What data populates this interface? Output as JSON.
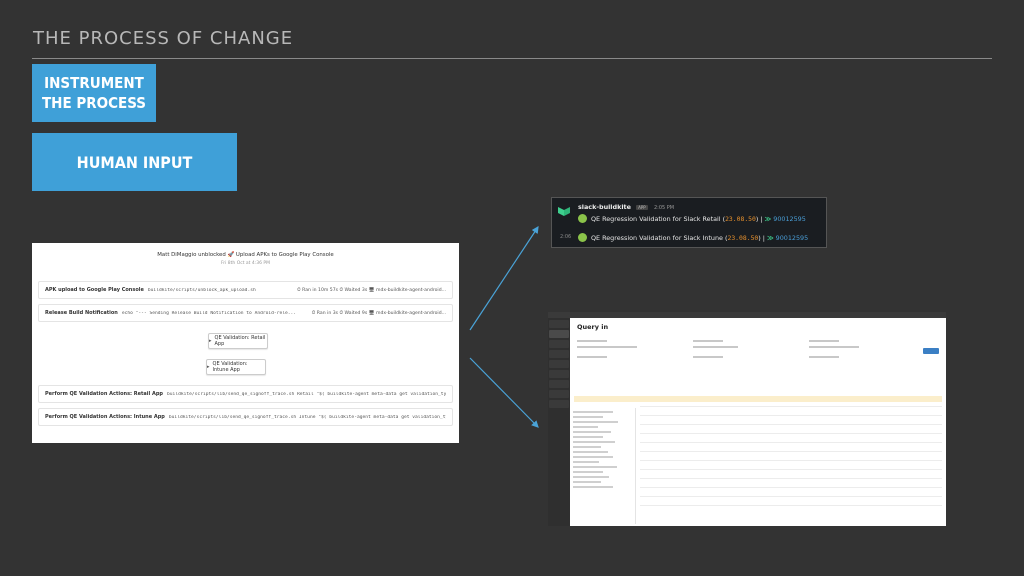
{
  "slide": {
    "title": "THE PROCESS OF CHANGE",
    "box1": "INSTRUMENT THE PROCESS",
    "box2": "HUMAN INPUT",
    "accent_color": "#3fa0d8"
  },
  "buildkite": {
    "header": "Matt DiMaggio unblocked 🚀 Upload APKs to Google Play Console",
    "subheader": "Fri 8th Oct at 4:36 PM",
    "steps": [
      {
        "label": "APK upload to Google Play Console",
        "cmd": "buildkite/scripts/unblock_apk_upload.sh",
        "meta": "⏱ Ran in 10m 57s  ⏱ Waited 3s  🖥 mdx-buildkite-agent-android..."
      },
      {
        "label": "Release Build Notification",
        "cmd": "echo \"--- Sending Release Build Notification to Android-rele...",
        "meta": "⏱ Ran in 3s  ⏱ Waited 9s  🖥 mdx-buildkite-agent-android..."
      }
    ],
    "buttons": [
      "QE Validation: Retail App",
      "QE Validation: Intune App"
    ],
    "perform_steps": [
      {
        "label": "Perform QE Validation Actions: Retail App",
        "cmd": "buildkite/scripts/lib/send_qe_signoff_trace.sh Retail \"$( buildkite-agent meta-data get validation_type..."
      },
      {
        "label": "Perform QE Validation Actions: Intune App",
        "cmd": "buildkite/scripts/lib/send_qe_signoff_trace.sh Intune \"$( buildkite-agent meta-data get validation_type..."
      }
    ]
  },
  "slack": {
    "bot_name": "slack-buildkite",
    "app_badge": "APP",
    "time": "2:05 PM",
    "time2": "2:06",
    "messages": [
      {
        "text": "QE Regression Validation for Slack Retail (",
        "version": "23.08.50",
        "close": ") |",
        "build": "90012595"
      },
      {
        "text": "QE Regression Validation for Slack Intune (",
        "version": "23.08.50",
        "close": ") |",
        "build": "90012595"
      }
    ]
  },
  "query": {
    "title": "Query in"
  }
}
